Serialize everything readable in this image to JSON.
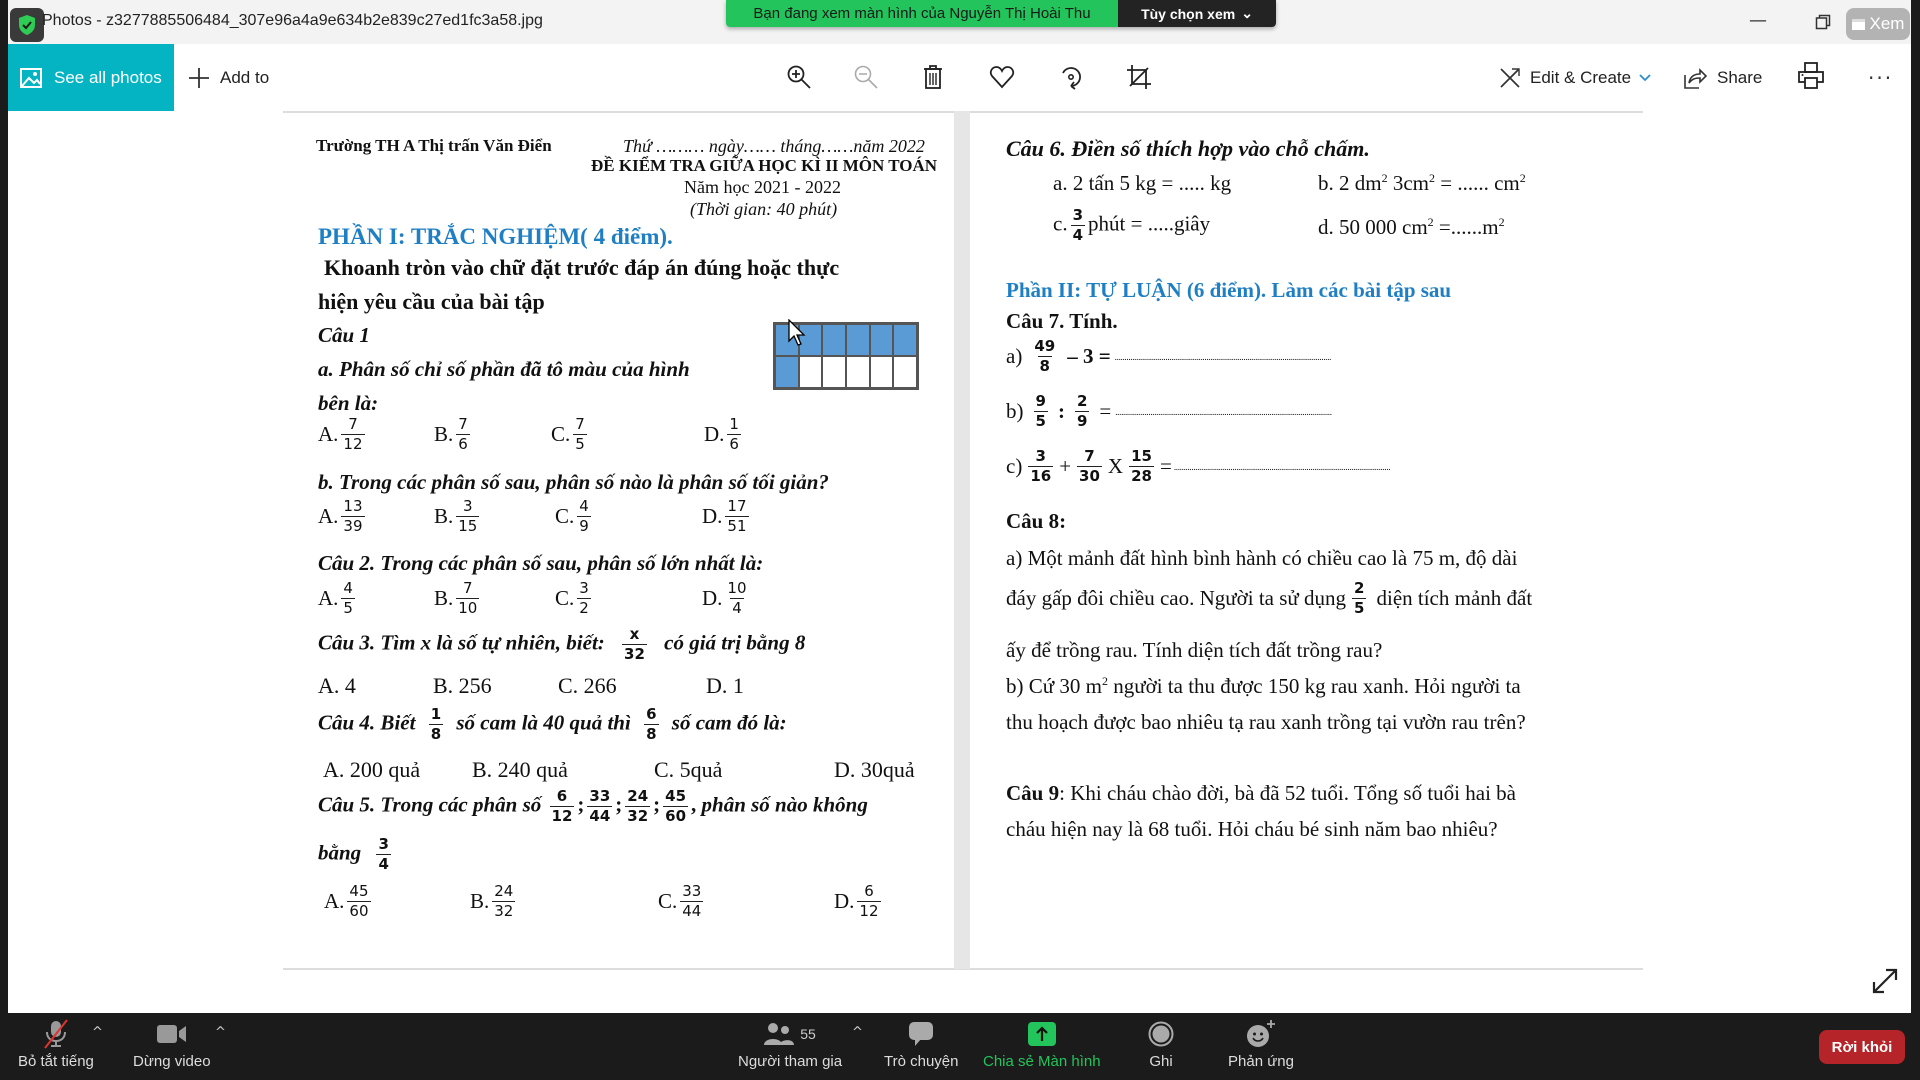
{
  "window": {
    "app_title": "Photos - z3277885506484_307e96a4a9e634b2e839c27ed1fc3a58.jpg",
    "minimize": "—",
    "view_pill": "Xem"
  },
  "share_banner": {
    "message": "Bạn đang xem màn hình của Nguyễn Thị Hoài Thu",
    "options_label": "Tùy chọn xem",
    "options_chevron": "⌄"
  },
  "toolbar": {
    "see_all_photos": "See all photos",
    "add_to": "Add to",
    "icons": [
      "zoom-in-icon",
      "zoom-out-icon",
      "delete-icon",
      "favorite-icon",
      "rotate-icon",
      "crop-icon"
    ],
    "edit_create": "Edit & Create",
    "share": "Share",
    "more": "···"
  },
  "document": {
    "left": {
      "school": "Trường TH A Thị trấn Văn Điển",
      "date_line": "Thứ ……… ngày…… tháng……năm 2022",
      "exam_title": "ĐỀ KIỂM TRA GIỮA HỌC KÌ II MÔN TOÁN",
      "school_year": "Năm học 2021 - 2022",
      "duration": "(Thời gian: 40 phút)",
      "part1_title": "PHẦN I: TRẮC NGHIỆM( 4 điểm).",
      "instruction_1": "Khoanh tròn vào chữ đặt trước đáp án đúng hoặc thực",
      "instruction_2": "hiện yêu cầu của bài tập",
      "q1_title": "Câu 1",
      "q1a_1": "a. Phân số chỉ số phần đã tô màu của hình",
      "q1a_2": "bên là:",
      "q1a_options": [
        {
          "label": "A.",
          "num": "7",
          "den": "12"
        },
        {
          "label": "B.",
          "num": "7",
          "den": "6"
        },
        {
          "label": "C.",
          "num": "7",
          "den": "5"
        },
        {
          "label": "D.",
          "num": "1",
          "den": "6"
        }
      ],
      "q1_figure": {
        "columns": 6,
        "rows": 2,
        "shaded_cells": 7
      },
      "q1b": "b. Trong các phân số sau, phân số nào là phân số tối giản?",
      "q1b_options": [
        {
          "label": "A.",
          "num": "13",
          "den": "39"
        },
        {
          "label": "B.",
          "num": "3",
          "den": "15"
        },
        {
          "label": "C.",
          "num": "4",
          "den": "9"
        },
        {
          "label": "D.",
          "num": "17",
          "den": "51"
        }
      ],
      "q2": "Câu 2. Trong các phân số sau, phân số lớn nhất là:",
      "q2_options": [
        {
          "label": "A.",
          "num": "4",
          "den": "5"
        },
        {
          "label": "B.",
          "num": "7",
          "den": "10"
        },
        {
          "label": "C.",
          "num": "3",
          "den": "2"
        },
        {
          "label": "D.",
          "num": "10",
          "den": "4"
        }
      ],
      "q3_pre": "Câu 3. Tìm x là số tự nhiên, biết:",
      "q3_frac": {
        "num": "x",
        "den": "32"
      },
      "q3_post": "có giá trị bằng 8",
      "q3_options": [
        "A. 4",
        "B.   256",
        "C. 266",
        "D. 1"
      ],
      "q4_pre": "Câu 4. Biết",
      "q4_frac1": {
        "num": "1",
        "den": "8"
      },
      "q4_mid": "số cam là 40  quả thì",
      "q4_frac2": {
        "num": "6",
        "den": "8"
      },
      "q4_post": "số cam đó là:",
      "q4_options": [
        "A. 200 quả",
        "B. 240 quả",
        "C. 5quả",
        "D. 30quả"
      ],
      "q5_pre": "Câu 5. Trong các phân số",
      "q5_fracs": [
        {
          "num": "6",
          "den": "12"
        },
        {
          "num": "33",
          "den": "44"
        },
        {
          "num": "24",
          "den": "32"
        },
        {
          "num": "45",
          "den": "60"
        }
      ],
      "q5_post": "phân số nào không",
      "q5_line2": "bằng",
      "q5_target": {
        "num": "3",
        "den": "4"
      },
      "q5_options": [
        {
          "label": "A.",
          "num": "45",
          "den": "60"
        },
        {
          "label": "B.",
          "num": "24",
          "den": "32"
        },
        {
          "label": "C.",
          "num": "33",
          "den": "44"
        },
        {
          "label": "D.",
          "num": "6",
          "den": "12"
        }
      ]
    },
    "right": {
      "q6_title": "Câu 6. Điền số thích hợp vào chỗ chấm.",
      "q6a": "a. 2 tấn 5 kg = ..... kg",
      "q6b_pre": "b. 2 dm",
      "q6b_mid": " 3cm",
      "q6b_post": "  = ...... cm",
      "q6c_label": "c.",
      "q6c_frac": {
        "num": "3",
        "den": "4"
      },
      "q6c_post": "phút  = .....giây",
      "q6d_pre": "d. 50 000 cm",
      "q6d_post": "   =......m",
      "sup2": "2",
      "part2_title": "Phần II: TỰ LUẬN (6 điểm). Làm các bài tập sau",
      "q7_title": "Câu 7. Tính.",
      "q7a_label": "a)",
      "q7a_frac": {
        "num": "49",
        "den": "8"
      },
      "q7a_post": "– 3 =",
      "q7b_label": "b)",
      "q7b_frac1": {
        "num": "9",
        "den": "5"
      },
      "q7b_op": ":",
      "q7b_frac2": {
        "num": "2",
        "den": "9"
      },
      "q7b_post": "=",
      "q7c_label": "c)",
      "q7c_frac1": {
        "num": "3",
        "den": "16"
      },
      "q7c_op1": "+",
      "q7c_frac2": {
        "num": "7",
        "den": "30"
      },
      "q7c_op2": "X",
      "q7c_frac3": {
        "num": "15",
        "den": "28"
      },
      "q7c_post": "=",
      "dots": "...............................................................................................................",
      "q8_title": "Câu 8:",
      "q8a_1": "a) Một mảnh đất hình bình hành có chiều cao là 75 m, độ dài",
      "q8a_2_pre": "đáy gấp đôi chiều cao. Người ta sử dụng",
      "q8a_frac": {
        "num": "2",
        "den": "5"
      },
      "q8a_2_post": "diện tích mảnh đất",
      "q8a_3": "ấy để trồng rau. Tính diện tích đất trồng rau?",
      "q8b_1_pre": "b) Cứ 30 m",
      "q8b_1_post": " người ta thu được 150 kg rau xanh. Hỏi người ta",
      "q8b_2": "thu hoạch được bao nhiêu tạ rau xanh trồng tại vườn rau trên?",
      "q9_label": "Câu 9",
      "q9_1": ": Khi cháu chào đời, bà đã 52 tuổi. Tổng số tuổi hai bà",
      "q9_2": "cháu hiện nay là 68 tuổi. Hỏi cháu bé sinh năm bao nhiêu?"
    }
  },
  "meeting_bar": {
    "mute": "Bỏ tắt tiếng",
    "video": "Dừng video",
    "participants": "Người tham gia",
    "participants_count": "55",
    "chat": "Trò chuyện",
    "share_screen": "Chia sẻ Màn hình",
    "record": "Ghi",
    "reactions": "Phản ứng",
    "leave": "Rời khỏi",
    "caret": "^"
  },
  "colors": {
    "teal": "#05b4c3",
    "banner_green": "#22c45b",
    "heading_blue": "#1f7fc4",
    "shaded_cell": "#5b9bd5",
    "leave_red": "#b52428"
  }
}
